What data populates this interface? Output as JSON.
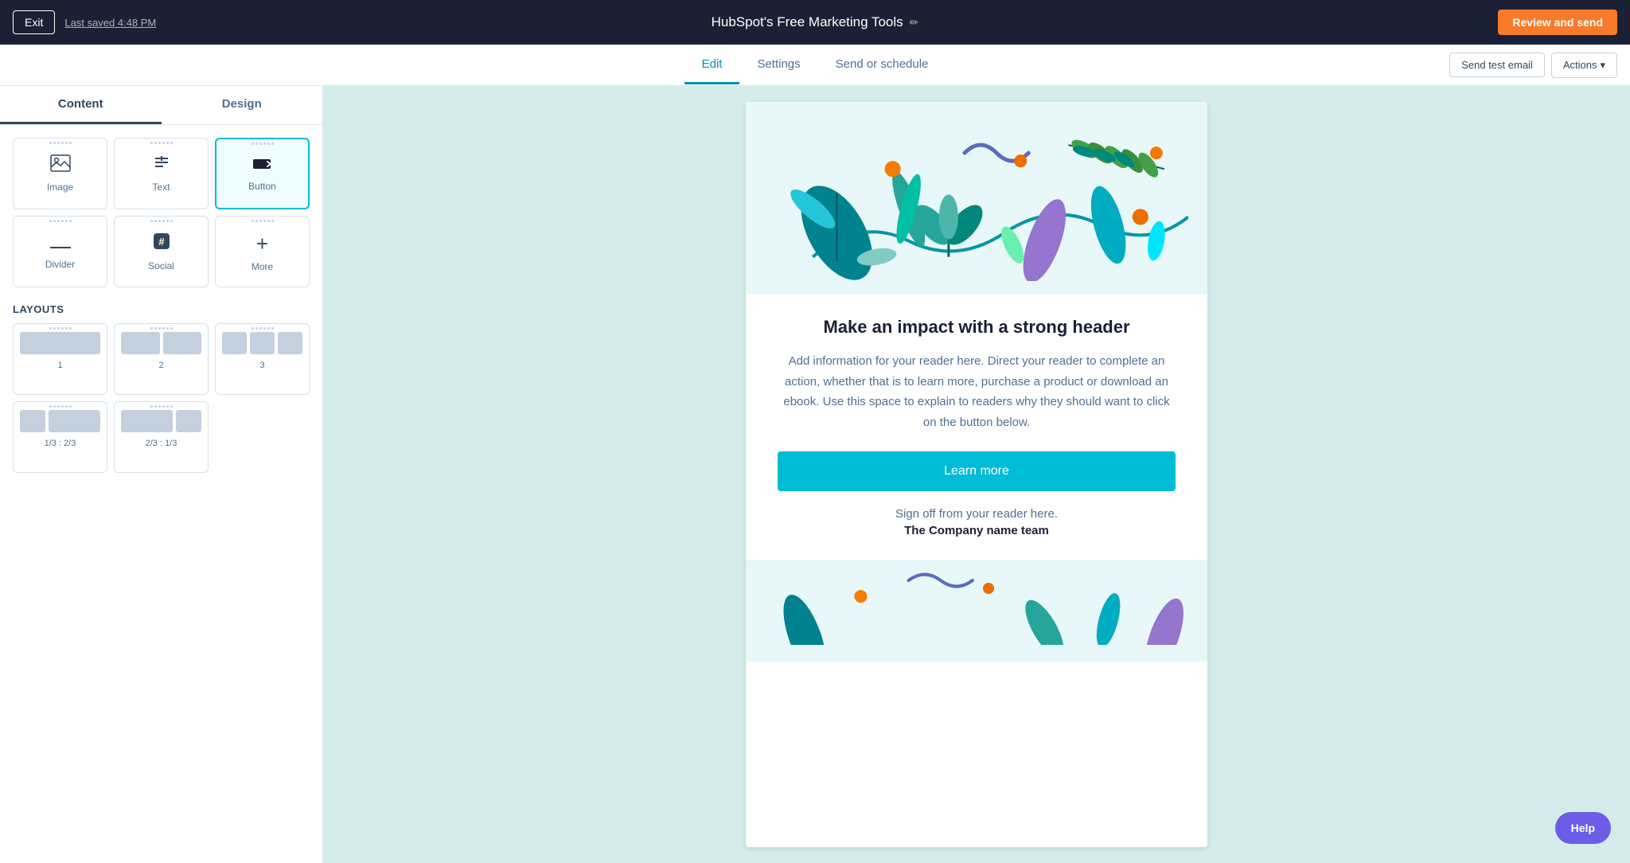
{
  "topbar": {
    "exit_label": "Exit",
    "last_saved": "Last saved 4:48 PM",
    "app_title": "HubSpot's Free Marketing Tools",
    "edit_icon": "✏",
    "review_send_label": "Review and send"
  },
  "nav": {
    "tabs": [
      {
        "id": "edit",
        "label": "Edit",
        "active": true
      },
      {
        "id": "settings",
        "label": "Settings",
        "active": false
      },
      {
        "id": "send_or_schedule",
        "label": "Send or schedule",
        "active": false
      }
    ],
    "send_test_label": "Send test email",
    "actions_label": "Actions"
  },
  "sidebar": {
    "content_tab": "Content",
    "design_tab": "Design",
    "blocks": [
      {
        "id": "image",
        "label": "Image",
        "icon": "image"
      },
      {
        "id": "text",
        "label": "Text",
        "icon": "text"
      },
      {
        "id": "button",
        "label": "Button",
        "icon": "button",
        "selected": true
      }
    ],
    "blocks_row2": [
      {
        "id": "divider",
        "label": "Divider",
        "icon": "divider"
      },
      {
        "id": "social",
        "label": "Social",
        "icon": "social"
      },
      {
        "id": "more",
        "label": "More",
        "icon": "more"
      }
    ],
    "layouts_label": "LAYOUTS",
    "layouts": [
      {
        "id": "1col",
        "label": "1",
        "cols": 1
      },
      {
        "id": "2col",
        "label": "2",
        "cols": 2
      },
      {
        "id": "3col",
        "label": "3",
        "cols": 3
      },
      {
        "id": "1-3_2-3",
        "label": "1/3 : 2/3",
        "cols": "unequal-left"
      },
      {
        "id": "2-3_1-3",
        "label": "2/3 : 1/3",
        "cols": "unequal-right"
      }
    ]
  },
  "email": {
    "heading": "Make an impact with a strong header",
    "body_text": "Add information for your reader here. Direct your reader to complete an action, whether that is to learn more, purchase a product or download an ebook. Use this space to explain to readers why they should want to click on the button below.",
    "learn_more_btn": "Learn more",
    "signoff": "Sign off from your reader here.",
    "company": "The Company name team"
  },
  "help": {
    "label": "Help"
  }
}
